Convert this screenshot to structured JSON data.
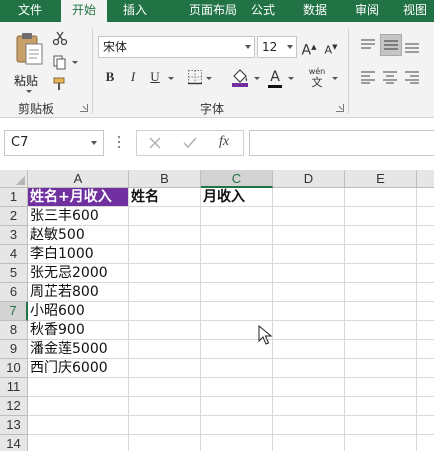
{
  "ribbon": {
    "tabs": [
      {
        "label": "文件",
        "active": false
      },
      {
        "label": "开始",
        "active": true
      },
      {
        "label": "插入",
        "active": false
      },
      {
        "label": "页面布局",
        "active": false
      },
      {
        "label": "公式",
        "active": false
      },
      {
        "label": "数据",
        "active": false
      },
      {
        "label": "审阅",
        "active": false
      },
      {
        "label": "视图",
        "active": false
      }
    ],
    "clipboard": {
      "paste_label": "粘贴",
      "group_label": "剪贴板"
    },
    "font": {
      "font_name": "宋体",
      "font_size": "12",
      "bold_label": "B",
      "italic_label": "I",
      "underline_label": "U",
      "grow_label": "A",
      "shrink_label": "A",
      "font_color_label": "A",
      "phonetic_label": "wén",
      "group_label": "字体"
    }
  },
  "formula_bar": {
    "name_box": "C7",
    "fx_label": "fx",
    "formula": ""
  },
  "sheet": {
    "columns": [
      "A",
      "B",
      "C",
      "D",
      "E"
    ],
    "rows": [
      "1",
      "2",
      "3",
      "4",
      "5",
      "6",
      "7",
      "8",
      "9",
      "10",
      "11",
      "12",
      "13",
      "14"
    ],
    "row1": {
      "a": "姓名+月收入",
      "b": "姓名",
      "c": "月收入"
    },
    "column_a": [
      "张三丰600",
      "赵敏500",
      "李白1000",
      "张无忌2000",
      "周芷若800",
      "小昭600",
      "秋香900",
      "潘金莲5000",
      "西门庆6000"
    ]
  },
  "colors": {
    "accent": "#217346",
    "highlight_fill": "#7030a0"
  }
}
